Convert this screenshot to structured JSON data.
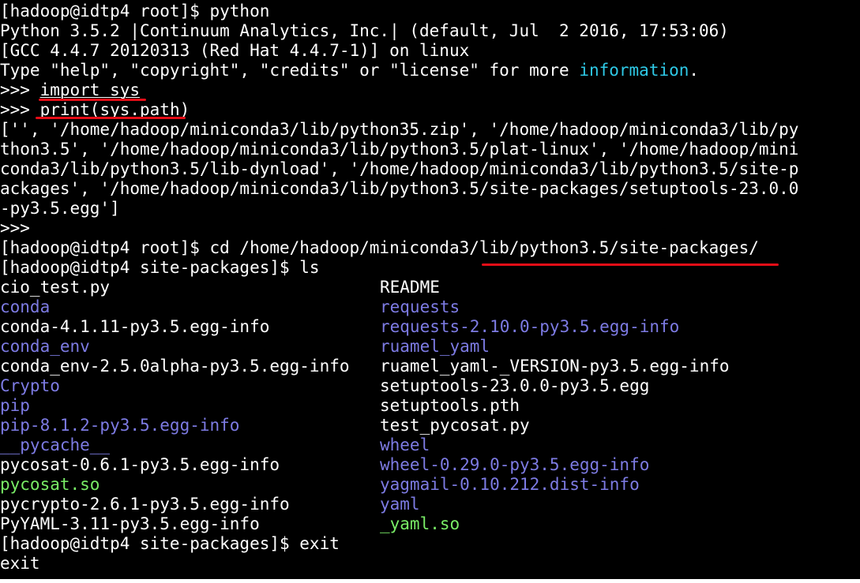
{
  "terminal": {
    "colors": {
      "background": "#000000",
      "text": "#ffffff",
      "cyan": "#2ec9e6",
      "blue": "#7d7be3",
      "green": "#79ec66",
      "annotation_red": "#e50d17"
    },
    "lines": {
      "l1": "[hadoop@idtp4 root]$ python",
      "l2": "Python 3.5.2 |Continuum Analytics, Inc.| (default, Jul  2 2016, 17:53:06)",
      "l3": "[GCC 4.4.7 20120313 (Red Hat 4.4.7-1)] on linux",
      "l4_start": "Type \"help\", \"copyright\", \"credits\" or \"license\" for more ",
      "l4_link": "information",
      "l4_end": ".",
      "l5_prompt": ">>> ",
      "l5_cmd": "import sys",
      "l6_prompt": ">>> ",
      "l6_cmd_a": "print(",
      "l6_cmd_b": "sys.path",
      "l6_cmd_c": ")",
      "l7": "['', '/home/hadoop/miniconda3/lib/python35.zip', '/home/hadoop/miniconda3/lib/py",
      "l8": "thon3.5', '/home/hadoop/miniconda3/lib/python3.5/plat-linux', '/home/hadoop/mini",
      "l9": "conda3/lib/python3.5/lib-dynload', '/home/hadoop/miniconda3/lib/python3.5/site-p",
      "l10": "ackages', '/home/hadoop/miniconda3/lib/python3.5/site-packages/setuptools-23.0.0",
      "l11": "-py3.5.egg']",
      "l12": ">>>",
      "l13": "[hadoop@idtp4 root]$ cd /home/hadoop/miniconda3/lib/python3.5/site-packages/",
      "l14": "[hadoop@idtp4 site-packages]$ ls",
      "l27": "[hadoop@idtp4 site-packages]$ exit",
      "l28": "exit"
    },
    "ls_left": [
      {
        "name": "cio_test.py",
        "kind": "file"
      },
      {
        "name": "conda",
        "kind": "dir"
      },
      {
        "name": "conda-4.1.11-py3.5.egg-info",
        "kind": "file"
      },
      {
        "name": "conda_env",
        "kind": "dir"
      },
      {
        "name": "conda_env-2.5.0alpha-py3.5.egg-info",
        "kind": "file"
      },
      {
        "name": "Crypto",
        "kind": "dir"
      },
      {
        "name": "pip",
        "kind": "dir"
      },
      {
        "name": "pip-8.1.2-py3.5.egg-info",
        "kind": "dir"
      },
      {
        "name": "__pycache__",
        "kind": "dir"
      },
      {
        "name": "pycosat-0.6.1-py3.5.egg-info",
        "kind": "file"
      },
      {
        "name": "pycosat.so",
        "kind": "exec"
      },
      {
        "name": "pycrypto-2.6.1-py3.5.egg-info",
        "kind": "file"
      },
      {
        "name": "PyYAML-3.11-py3.5.egg-info",
        "kind": "file"
      }
    ],
    "ls_right": [
      {
        "name": "README",
        "kind": "file"
      },
      {
        "name": "requests",
        "kind": "dir"
      },
      {
        "name": "requests-2.10.0-py3.5.egg-info",
        "kind": "dir"
      },
      {
        "name": "ruamel_yaml",
        "kind": "dir"
      },
      {
        "name": "ruamel_yaml-_VERSION-py3.5.egg-info",
        "kind": "file"
      },
      {
        "name": "setuptools-23.0.0-py3.5.egg",
        "kind": "file"
      },
      {
        "name": "setuptools.pth",
        "kind": "file"
      },
      {
        "name": "test_pycosat.py",
        "kind": "file"
      },
      {
        "name": "wheel",
        "kind": "dir"
      },
      {
        "name": "wheel-0.29.0-py3.5.egg-info",
        "kind": "dir"
      },
      {
        "name": "yagmail-0.10.212.dist-info",
        "kind": "dir"
      },
      {
        "name": "yaml",
        "kind": "dir"
      },
      {
        "name": "_yaml.so",
        "kind": "exec"
      }
    ]
  }
}
